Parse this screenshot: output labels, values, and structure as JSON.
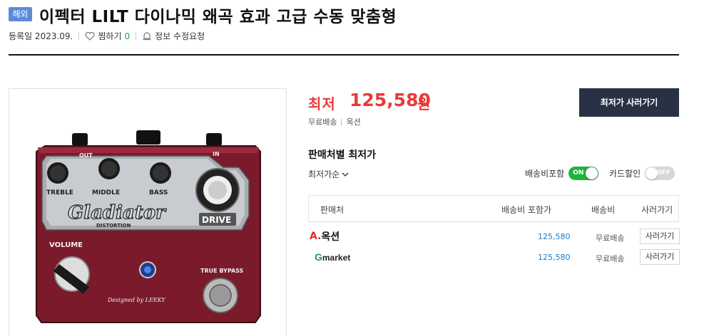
{
  "header": {
    "badge": "해외",
    "title": "이펙터 LILT 다이나믹 왜곡 효과 고급 수동 맞춤형",
    "registered": "등록일 2023.09.",
    "zzim_label": "찜하기",
    "zzim_count": "0",
    "report_label": "정보 수정요청"
  },
  "product_image": {
    "top_labels": [
      "OUT",
      "IN"
    ],
    "knob_labels": [
      "TREBLE",
      "MIDDLE",
      "BASS"
    ],
    "brand": "Gladiator",
    "subtitle": "DISTORTION",
    "drive_label": "DRIVE",
    "volume_label": "VOLUME",
    "bypass_label": "TRUE BYPASS",
    "designed": "Designed by LEEKY"
  },
  "price": {
    "label": "최저",
    "value": "125,580",
    "unit": "원",
    "shipping": "무료배송",
    "seller": "옥션",
    "buy_button": "최저가 사러가기"
  },
  "sellers_section": {
    "title": "판매처별 최저가",
    "sort_label": "최저가순",
    "shipping_toggle": {
      "label": "배송비포함",
      "state": "ON"
    },
    "card_toggle": {
      "label": "카드할인",
      "state": "OFF"
    },
    "columns": [
      "판매처",
      "배송비 포함가",
      "배송비",
      "사러가기"
    ],
    "rows": [
      {
        "seller_mark": "A.",
        "seller_name": "옥션",
        "price": "125,580",
        "shipping": "무료배송",
        "action": "사러가기"
      },
      {
        "seller_mark": "G",
        "seller_name": "market",
        "price": "125,580",
        "shipping": "무료배송",
        "action": "사러가기"
      }
    ]
  },
  "colors": {
    "accent_price": "#e93a3a",
    "buy_button_bg": "#293245",
    "toggle_on": "#1fb43c",
    "badge_bg": "#5b8ad9",
    "pedal_body": "#7a1a2b"
  }
}
